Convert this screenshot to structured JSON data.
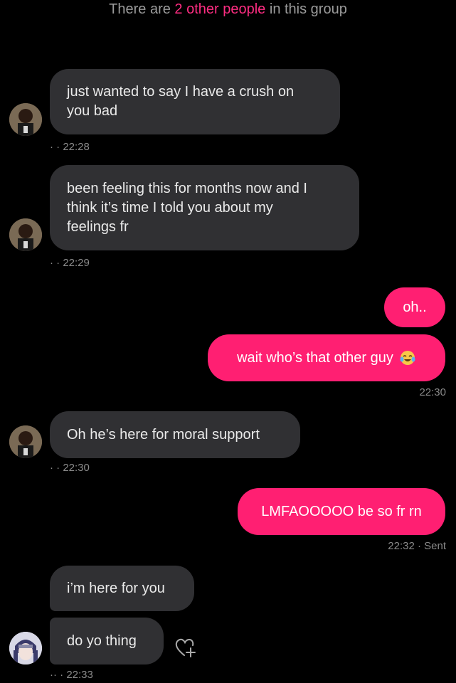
{
  "banner": {
    "prefix": "There are ",
    "highlight": "2 other people",
    "suffix": " in this group"
  },
  "messages": [
    {
      "side": "in",
      "text_line1": "just wanted to say I have a crush on",
      "text_line2": "you bad",
      "time": "· · 22:28"
    },
    {
      "side": "in",
      "text_line1": "been feeling this for months now and I",
      "text_line2": "think it’s time I told you about my",
      "text_line3": "feelings fr",
      "time": "· · 22:29"
    },
    {
      "side": "out",
      "text": "oh.."
    },
    {
      "side": "out",
      "text": "wait who’s that other guy",
      "emoji": "crying-laughing-emoji",
      "time": "22:30"
    },
    {
      "side": "in",
      "text": "Oh he’s here for moral support",
      "time": "· · 22:30"
    },
    {
      "side": "out",
      "text": "LMFAOOOOO be so fr rn",
      "time": "22:32 · Sent"
    },
    {
      "side": "in",
      "text": "i’m here for you"
    },
    {
      "side": "in",
      "text": "do yo thing",
      "time": "·· · 22:33"
    }
  ],
  "icons": {
    "react": "heart-plus-icon"
  },
  "colors": {
    "background": "#000000",
    "incoming_bubble": "#303033",
    "outgoing_bubble": "#ff1f72",
    "accent": "#ff2d82",
    "meta_text": "#8a8a8a"
  }
}
